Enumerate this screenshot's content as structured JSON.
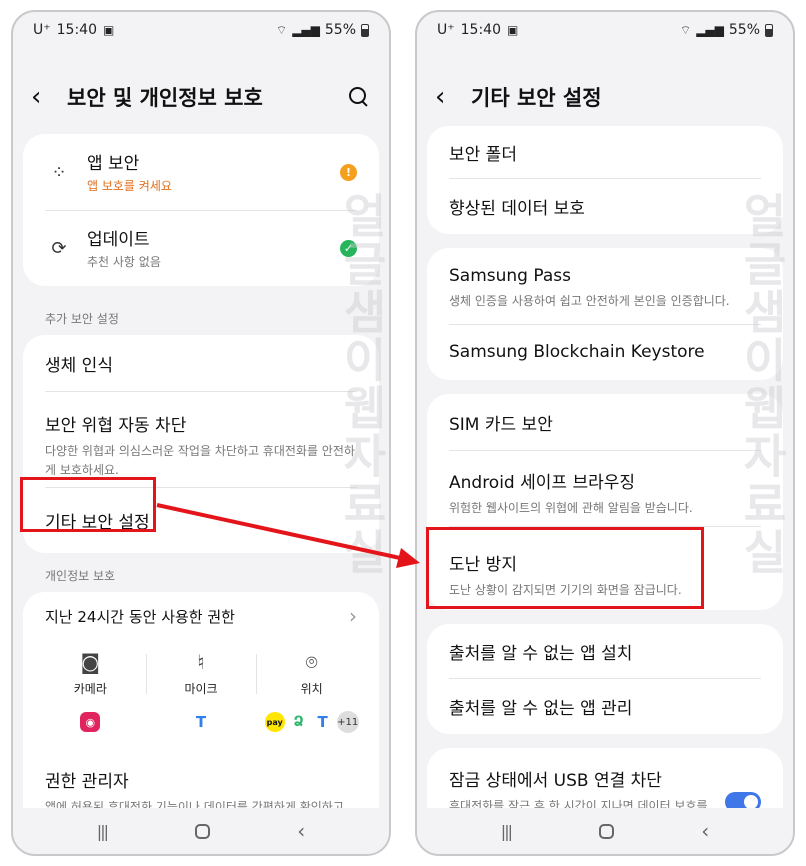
{
  "status": {
    "carrier": "U⁺",
    "time": "15:40",
    "battery": "55%"
  },
  "watermark": "얼글샘이웹자료실",
  "left": {
    "title": "보안 및 개인정보 보호",
    "app_security": {
      "title": "앱 보안",
      "subtitle": "앱 보호를 켜세요"
    },
    "update": {
      "title": "업데이트",
      "subtitle": "추천 사항 없음"
    },
    "section_more_security": "추가 보안 설정",
    "biometrics": "생체 인식",
    "auto_block": {
      "title": "보안 위협 자동 차단",
      "subtitle": "다양한 위협과 의심스러운 작업을 차단하고 휴대전화를 안전하게 보호하세요."
    },
    "other_security": "기타 보안 설정",
    "section_privacy": "개인정보 보호",
    "perm_24h": "지난 24시간 동안 사용한 권한",
    "permissions": [
      {
        "icon": "camera-icon",
        "label": "카메라"
      },
      {
        "icon": "microphone-icon",
        "label": "마이크"
      },
      {
        "icon": "location-icon",
        "label": "위치"
      }
    ],
    "app_badges": {
      "camera": [
        "camera-app"
      ],
      "mic": [
        "T"
      ],
      "location": [
        "pay",
        "map",
        "T"
      ],
      "location_more": "+11"
    },
    "perm_manager": {
      "title": "권한 관리자",
      "subtitle": "앱에 허용된 휴대전화 기능이나 데이터를 간편하게 확인하고"
    }
  },
  "right": {
    "title": "기타 보안 설정",
    "secure_folder": "보안 폴더",
    "enhanced_data": "향상된 데이터 보호",
    "samsung_pass": {
      "title": "Samsung Pass",
      "subtitle": "생체 인증을 사용하여 쉽고 안전하게 본인을 인증합니다."
    },
    "blockchain": "Samsung Blockchain Keystore",
    "sim_lock": "SIM 카드 보안",
    "safe_browsing": {
      "title": "Android 세이프 브라우징",
      "subtitle": "위험한 웹사이트의 위협에 관해 알림을 받습니다."
    },
    "theft_protection": {
      "title": "도난 방지",
      "subtitle": "도난 상황이 감지되면 기기의 화면을 잠급니다."
    },
    "unknown_install": "출처를 알 수 없는 앱 설치",
    "unknown_manage": "출처를 알 수 없는 앱 관리",
    "usb_block": {
      "title": "잠금 상태에서 USB 연결 차단",
      "subtitle": "휴대전화를 잠근 후 한 시간이 지나면 데이터 보호를"
    }
  },
  "colors": {
    "highlight": "#e3151a",
    "warning": "#f4a01e",
    "ok": "#27b55c",
    "toggle_on": "#3f76e8"
  }
}
